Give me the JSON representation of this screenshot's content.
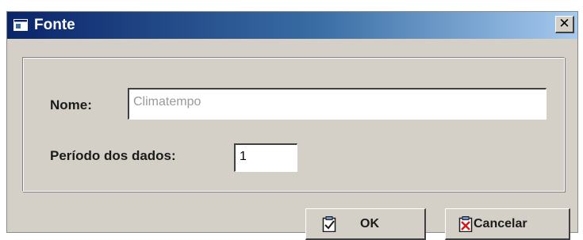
{
  "window": {
    "title": "Fonte",
    "close_glyph": "✕"
  },
  "form": {
    "nome_label": "Nome:",
    "nome_value": "Climatempo",
    "periodo_label": "Período dos dados:",
    "periodo_value": "1"
  },
  "buttons": {
    "ok_label": "OK",
    "cancel_label": "Cancelar"
  },
  "icons": {
    "title": "window-app-icon",
    "ok": "check-clipboard-icon",
    "cancel": "x-clipboard-icon"
  },
  "colors": {
    "titlebar_start": "#0a246a",
    "titlebar_end": "#a6caf0",
    "dialog_face": "#d4d0c8"
  }
}
